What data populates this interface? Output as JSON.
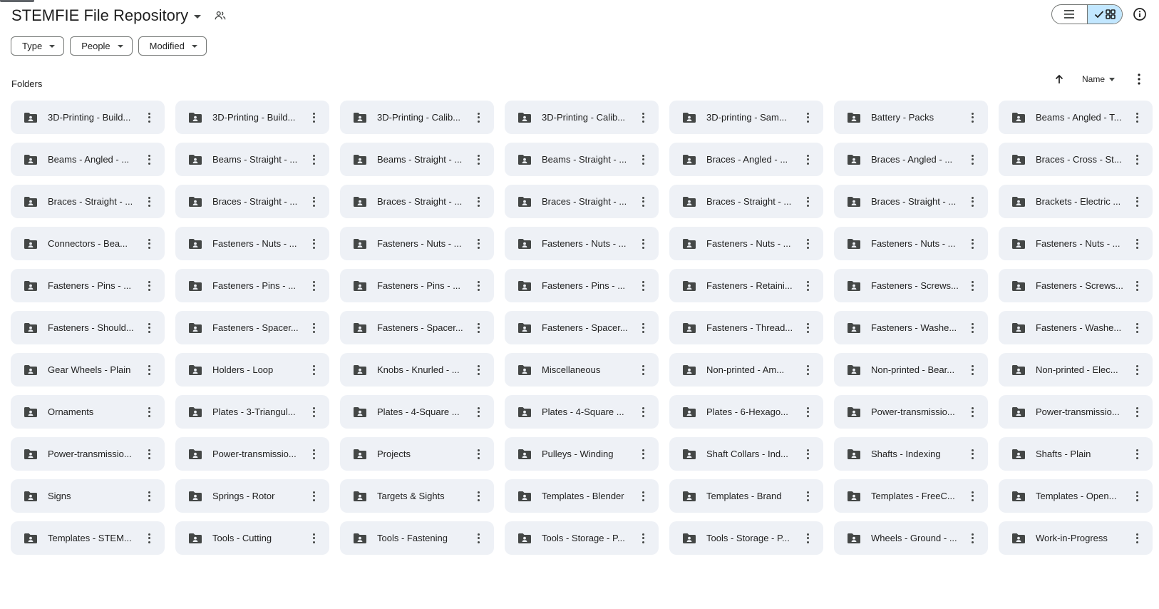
{
  "header": {
    "title": "STEMFIE File Repository",
    "title_dropdown_icon": "caret-down-icon",
    "shared_icon": "shared-people-icon"
  },
  "view_toggle": {
    "list_icon": "list-view-icon",
    "grid_icon": "grid-view-icon",
    "selected": "grid"
  },
  "info_icon": "info-icon",
  "filters": [
    {
      "label": "Type"
    },
    {
      "label": "People"
    },
    {
      "label": "Modified"
    }
  ],
  "section": {
    "label": "Folders"
  },
  "sort": {
    "direction_icon": "arrow-up-icon",
    "label": "Name"
  },
  "colors": {
    "accent": "#c2e7ff",
    "folder_bg": "#eef1f6",
    "icon": "#444746"
  },
  "folders": [
    {
      "name": "3D-Printing - Build..."
    },
    {
      "name": "3D-Printing - Build..."
    },
    {
      "name": "3D-Printing - Calib..."
    },
    {
      "name": "3D-Printing - Calib..."
    },
    {
      "name": "3D-printing - Sam..."
    },
    {
      "name": "Battery - Packs"
    },
    {
      "name": "Beams - Angled - T..."
    },
    {
      "name": "Beams - Angled - ..."
    },
    {
      "name": "Beams - Straight - ..."
    },
    {
      "name": "Beams - Straight - ..."
    },
    {
      "name": "Beams - Straight - ..."
    },
    {
      "name": "Braces - Angled - ..."
    },
    {
      "name": "Braces - Angled - ..."
    },
    {
      "name": "Braces - Cross - St..."
    },
    {
      "name": "Braces - Straight - ..."
    },
    {
      "name": "Braces - Straight - ..."
    },
    {
      "name": "Braces - Straight - ..."
    },
    {
      "name": "Braces - Straight - ..."
    },
    {
      "name": "Braces - Straight - ..."
    },
    {
      "name": "Braces - Straight - ..."
    },
    {
      "name": "Brackets - Electric ..."
    },
    {
      "name": "Connectors - Bea..."
    },
    {
      "name": "Fasteners - Nuts - ..."
    },
    {
      "name": "Fasteners - Nuts - ..."
    },
    {
      "name": "Fasteners - Nuts - ..."
    },
    {
      "name": "Fasteners - Nuts - ..."
    },
    {
      "name": "Fasteners - Nuts - ..."
    },
    {
      "name": "Fasteners - Nuts - ..."
    },
    {
      "name": "Fasteners - Pins - ..."
    },
    {
      "name": "Fasteners - Pins - ..."
    },
    {
      "name": "Fasteners - Pins - ..."
    },
    {
      "name": "Fasteners - Pins - ..."
    },
    {
      "name": "Fasteners - Retaini..."
    },
    {
      "name": "Fasteners - Screws..."
    },
    {
      "name": "Fasteners - Screws..."
    },
    {
      "name": "Fasteners - Should..."
    },
    {
      "name": "Fasteners - Spacer..."
    },
    {
      "name": "Fasteners - Spacer..."
    },
    {
      "name": "Fasteners - Spacer..."
    },
    {
      "name": "Fasteners - Thread..."
    },
    {
      "name": "Fasteners - Washe..."
    },
    {
      "name": "Fasteners - Washe..."
    },
    {
      "name": "Gear Wheels - Plain"
    },
    {
      "name": "Holders - Loop"
    },
    {
      "name": "Knobs - Knurled - ..."
    },
    {
      "name": "Miscellaneous"
    },
    {
      "name": "Non-printed - Am..."
    },
    {
      "name": "Non-printed - Bear..."
    },
    {
      "name": "Non-printed - Elec..."
    },
    {
      "name": "Ornaments"
    },
    {
      "name": "Plates - 3-Triangul..."
    },
    {
      "name": "Plates - 4-Square ..."
    },
    {
      "name": "Plates - 4-Square ..."
    },
    {
      "name": "Plates - 6-Hexago..."
    },
    {
      "name": "Power-transmissio..."
    },
    {
      "name": "Power-transmissio..."
    },
    {
      "name": "Power-transmissio..."
    },
    {
      "name": "Power-transmissio..."
    },
    {
      "name": "Projects"
    },
    {
      "name": "Pulleys - Winding"
    },
    {
      "name": "Shaft Collars - Ind..."
    },
    {
      "name": "Shafts - Indexing"
    },
    {
      "name": "Shafts - Plain"
    },
    {
      "name": "Signs"
    },
    {
      "name": "Springs - Rotor"
    },
    {
      "name": "Targets & Sights"
    },
    {
      "name": "Templates - Blender"
    },
    {
      "name": "Templates - Brand"
    },
    {
      "name": "Templates - FreeC..."
    },
    {
      "name": "Templates - Open..."
    },
    {
      "name": "Templates - STEM..."
    },
    {
      "name": "Tools - Cutting"
    },
    {
      "name": "Tools - Fastening"
    },
    {
      "name": "Tools - Storage - P..."
    },
    {
      "name": "Tools - Storage - P..."
    },
    {
      "name": "Wheels - Ground - ..."
    },
    {
      "name": "Work-in-Progress"
    }
  ]
}
